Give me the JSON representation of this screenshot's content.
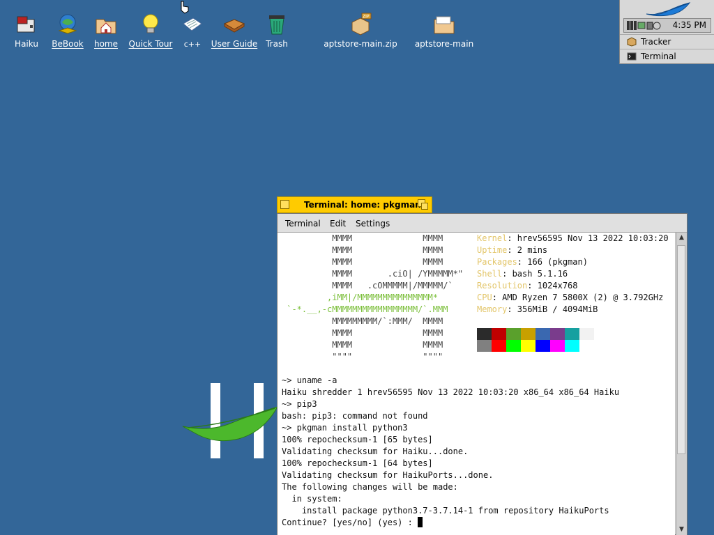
{
  "desktop": {
    "icons": [
      {
        "label": "Haiku",
        "name": "haiku-volume-icon"
      },
      {
        "label": "BeBook",
        "name": "bebook-icon"
      },
      {
        "label": "home",
        "name": "home-folder-icon"
      },
      {
        "label": "Quick Tour",
        "name": "lightbulb-icon"
      },
      {
        "label": "c++",
        "name": "document-icon"
      },
      {
        "label": "User Guide",
        "name": "book-icon"
      },
      {
        "label": "Trash",
        "name": "trash-icon"
      },
      {
        "label": "aptstore-main.zip",
        "name": "zip-package-icon"
      },
      {
        "label": "aptstore-main",
        "name": "folder-icon"
      }
    ]
  },
  "deskbar": {
    "clock": "4:35 PM",
    "items": [
      {
        "label": "Tracker"
      },
      {
        "label": "Terminal"
      }
    ]
  },
  "terminal": {
    "title": "Terminal: home: pkgman",
    "menus": [
      "Terminal",
      "Edit",
      "Settings"
    ],
    "art": [
      "          MMMM              MMMM",
      "          MMMM              MMMM",
      "          MMMM              MMMM",
      "          MMMM       .ciO| /YMMMMM*\"",
      "          MMMM   .cOMMMMM|/MMMMM/`",
      "         ,iMM|/MMMMMMMMMMMMMMM*",
      " `-*.__,-cMMMMMMMMMMMMMMMMM/`.MMM",
      "          MMMMMMMMM/`:MMM/  MMMM",
      "          MMMM              MMMM",
      "          MMMM              MMMM",
      "          \"\"\"\"              \"\"\"\""
    ],
    "sysinfo": [
      {
        "key": "Kernel",
        "value": ": hrev56595 Nov 13 2022 10:03:20"
      },
      {
        "key": "Uptime",
        "value": ": 2 mins"
      },
      {
        "key": "Packages",
        "value": ": 166 (pkgman)"
      },
      {
        "key": "Shell",
        "value": ": bash 5.1.16"
      },
      {
        "key": "Resolution",
        "value": ": 1024x768"
      },
      {
        "key": "CPU",
        "value": ": AMD Ryzen 7 5800X (2) @ 3.792GHz"
      },
      {
        "key": "Memory",
        "value": ": 356MiB / 4094MiB"
      }
    ],
    "palette_top": [
      "#2b2b2b",
      "#c00000",
      "#5aa02c",
      "#c8a000",
      "#3a68b0",
      "#7a3c8c",
      "#16a0a0",
      "#f2f2f2"
    ],
    "palette_bottom": [
      "#808080",
      "#ff0000",
      "#00ff00",
      "#ffff00",
      "#0000ff",
      "#ff00ff",
      "#00ffff",
      "#ffffff"
    ],
    "output": [
      "~> uname -a",
      "Haiku shredder 1 hrev56595 Nov 13 2022 10:03:20 x86_64 x86_64 Haiku",
      "~> pip3",
      "bash: pip3: command not found",
      "~> pkgman install python3",
      "100% repochecksum-1 [65 bytes]",
      "Validating checksum for Haiku...done.",
      "100% repochecksum-1 [64 bytes]",
      "Validating checksum for HaikuPorts...done.",
      "The following changes will be made:",
      "  in system:",
      "    install package python3.7-3.7.14-1 from repository HaikuPorts",
      "Continue? [yes/no] (yes) : "
    ]
  }
}
